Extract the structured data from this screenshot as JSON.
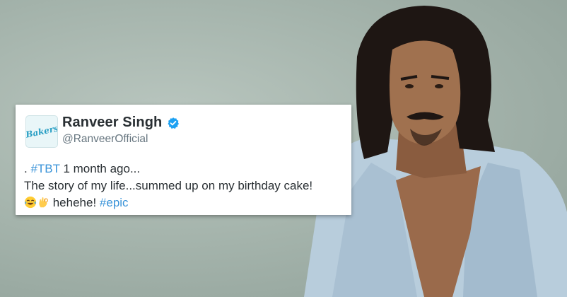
{
  "tweet": {
    "display_name": "Ranveer Singh",
    "handle": "@RanveerOfficial",
    "avatar_text": "Bakers",
    "line1_prefix": ". ",
    "line1_hashtag": "#TBT",
    "line1_rest": " 1 month ago...",
    "line2": "The story of my life...summed up on my birthday cake!",
    "line3_text": " hehehe! ",
    "line3_hashtag": "#epic",
    "emojis": [
      "face-with-tears-of-joy-icon",
      "ok-hand-icon"
    ],
    "colors": {
      "hashtag": "#3b94d9",
      "verified": "#1da1f2",
      "name": "#292f33",
      "handle": "#66757f"
    }
  }
}
